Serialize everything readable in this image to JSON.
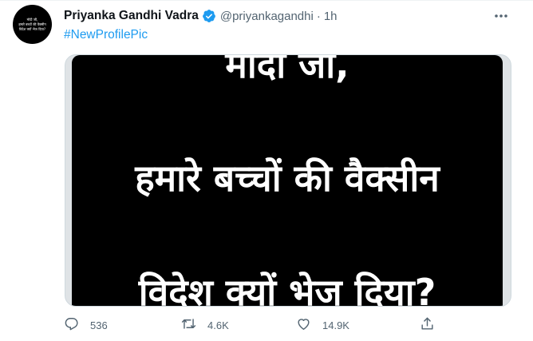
{
  "tweet": {
    "author_name": "Priyanka Gandhi Vadra",
    "handle": "@priyankagandhi",
    "separator": "·",
    "timestamp": "1h",
    "hashtag": "#NewProfilePic",
    "verified": true,
    "accent_color": "#1d9bf0"
  },
  "avatar": {
    "lines": [
      "मोदी जी,",
      "हमारे बच्चों की वैक्सीन",
      "विदेश क्यों भेज दिया?"
    ]
  },
  "media": {
    "lines": [
      "मोदी जी,",
      "हमारे बच्चों की वैक्सीन",
      "विदेश क्यों भेज दिया?"
    ]
  },
  "actions": {
    "reply": {
      "icon": "reply-icon",
      "count": "536"
    },
    "retweet": {
      "icon": "retweet-icon",
      "count": "4.6K"
    },
    "like": {
      "icon": "heart-icon",
      "count": "14.9K"
    },
    "share": {
      "icon": "share-icon"
    }
  },
  "more_icon": "more-icon"
}
